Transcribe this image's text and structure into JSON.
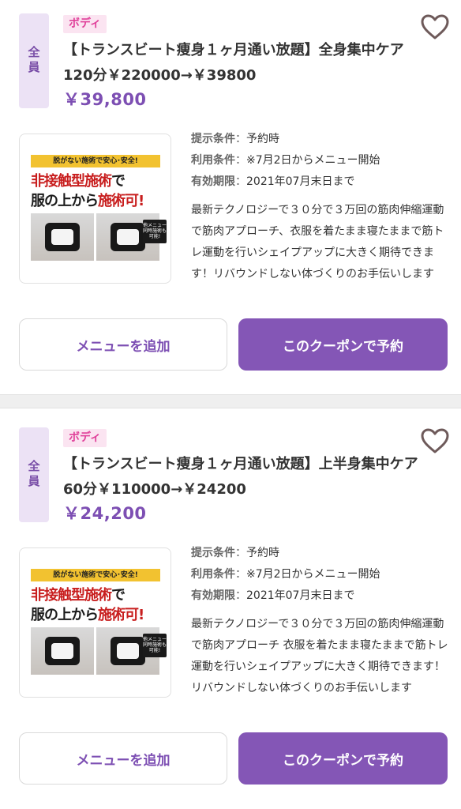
{
  "coupons": [
    {
      "target": "全員",
      "category": "ボディ",
      "title": "【トランスビート痩身１ヶ月通い放題】全身集中ケア120分￥220000→￥39800",
      "price": "￥39,800",
      "thumbnail": {
        "banner": "脱がない施術で安心･安全!",
        "line1_red": "非接触型施術",
        "line1_black": "で",
        "line2_black": "服の上から",
        "line2_red": "施術可!",
        "note": "他メニュー同時施術も可能!"
      },
      "conditions": [
        {
          "label": "提示条件",
          "value": "予約時"
        },
        {
          "label": "利用条件",
          "value": "※7月2日からメニュー開始"
        },
        {
          "label": "有効期限",
          "value": "2021年07月末日まで"
        }
      ],
      "description": "最新テクノロジーで３０分で３万回の筋肉伸縮運動で筋肉アプローチ、衣服を着たまま寝たままで筋トレ運動を行いシェイプアップに大きく期待できます！リバウンドしない体づくりのお手伝いします",
      "add_menu_label": "メニューを追加",
      "reserve_label": "このクーポンで予約"
    },
    {
      "target": "全員",
      "category": "ボディ",
      "title": "【トランスビート痩身１ヶ月通い放題】上半身集中ケア60分￥110000→￥24200",
      "price": "￥24,200",
      "thumbnail": {
        "banner": "脱がない施術で安心･安全!",
        "line1_red": "非接触型施術",
        "line1_black": "で",
        "line2_black": "服の上から",
        "line2_red": "施術可!",
        "note": "他メニュー同時施術も可能!"
      },
      "conditions": [
        {
          "label": "提示条件",
          "value": "予約時"
        },
        {
          "label": "利用条件",
          "value": "※7月2日からメニュー開始"
        },
        {
          "label": "有効期限",
          "value": "2021年07月末日まで"
        }
      ],
      "description": "最新テクノロジーで３０分で３万回の筋肉伸縮運動で筋肉アプローチ 衣服を着たまま寝たままで筋トレ運動を行いシェイプアップに大きく期待できます！リバウンドしない体づくりのお手伝いします",
      "add_menu_label": "メニューを追加",
      "reserve_label": "このクーポンで予約"
    }
  ],
  "icons": {
    "favorite": "heart-outline-icon"
  },
  "colors": {
    "accent": "#8456b6",
    "price": "#7d4fb3",
    "category": "#e0409a",
    "target_bg": "#ece2f5"
  }
}
